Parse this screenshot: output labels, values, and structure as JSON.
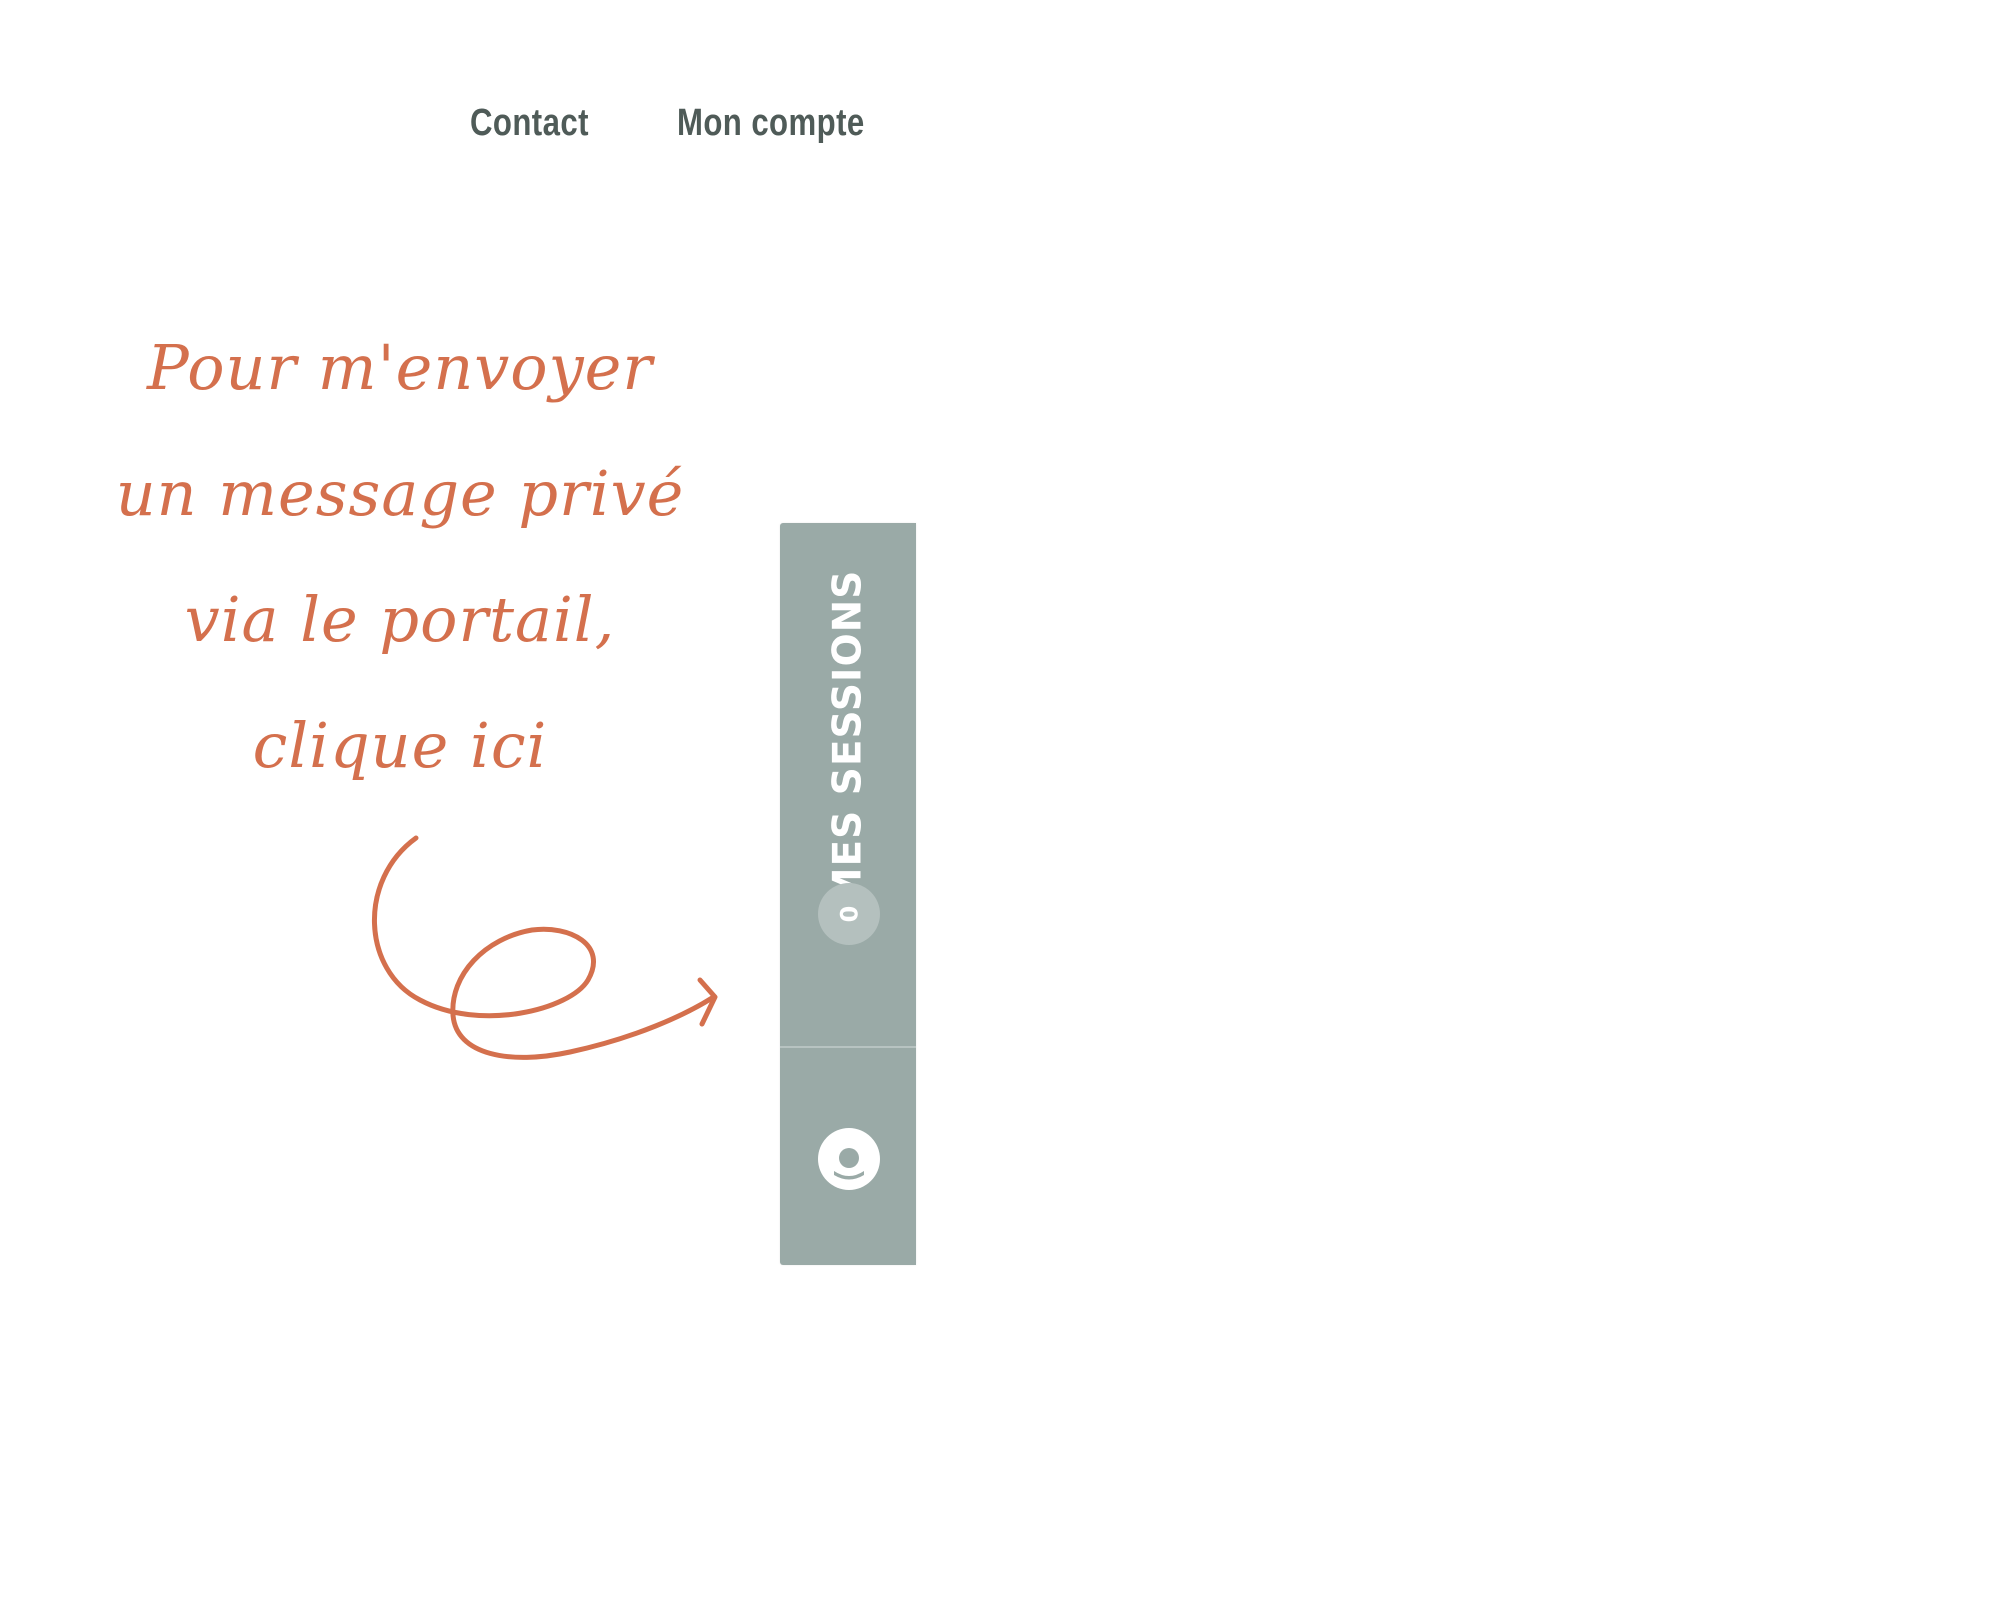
{
  "nav": {
    "contact_label": "Contact",
    "account_label": "Mon compte"
  },
  "annotation": {
    "lines": [
      "Pour m'envoyer",
      "un message privé",
      "via le portail,",
      "clique ici"
    ],
    "color": "#d4704d"
  },
  "sidebar": {
    "sessions_label": "MES SESSIONS",
    "sessions_count": "0",
    "background_color": "#9aaaa7",
    "icons": {
      "account": "user-circle-icon"
    }
  }
}
